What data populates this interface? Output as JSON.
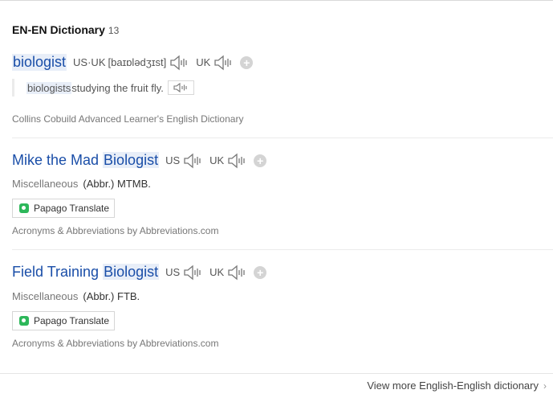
{
  "section": {
    "title": "EN-EN Dictionary",
    "count": "13"
  },
  "entries": [
    {
      "word": "biologist",
      "pron_label": "US·UK",
      "phonetic": "[baɪɒlədʒɪst]",
      "uk_label": "UK",
      "example": {
        "highlight": "biologists",
        "rest": " studying the fruit fly."
      },
      "source": "Collins Cobuild Advanced Learner's English Dictionary"
    },
    {
      "word_prefix": "Mike the Mad ",
      "word_highlight": "Biologist",
      "us_label": "US",
      "uk_label": "UK",
      "category": "Miscellaneous",
      "definition": "(Abbr.) MTMB.",
      "translate": "Papago Translate",
      "source": "Acronyms & Abbreviations by Abbreviations.com"
    },
    {
      "word_prefix": "Field Training ",
      "word_highlight": "Biologist",
      "us_label": "US",
      "uk_label": "UK",
      "category": "Miscellaneous",
      "definition": "(Abbr.) FTB.",
      "translate": "Papago Translate",
      "source": "Acronyms & Abbreviations by Abbreviations.com"
    }
  ],
  "footer": {
    "more_label": "View more English-English dictionary"
  },
  "icons": {
    "speaker": "speaker-icon",
    "add": "plus-icon",
    "papago": "papago-icon",
    "chevron": "chevron-right-icon"
  },
  "colors": {
    "link": "#1a4ea8",
    "highlight": "#e8eef8",
    "papago": "#2db75a"
  }
}
